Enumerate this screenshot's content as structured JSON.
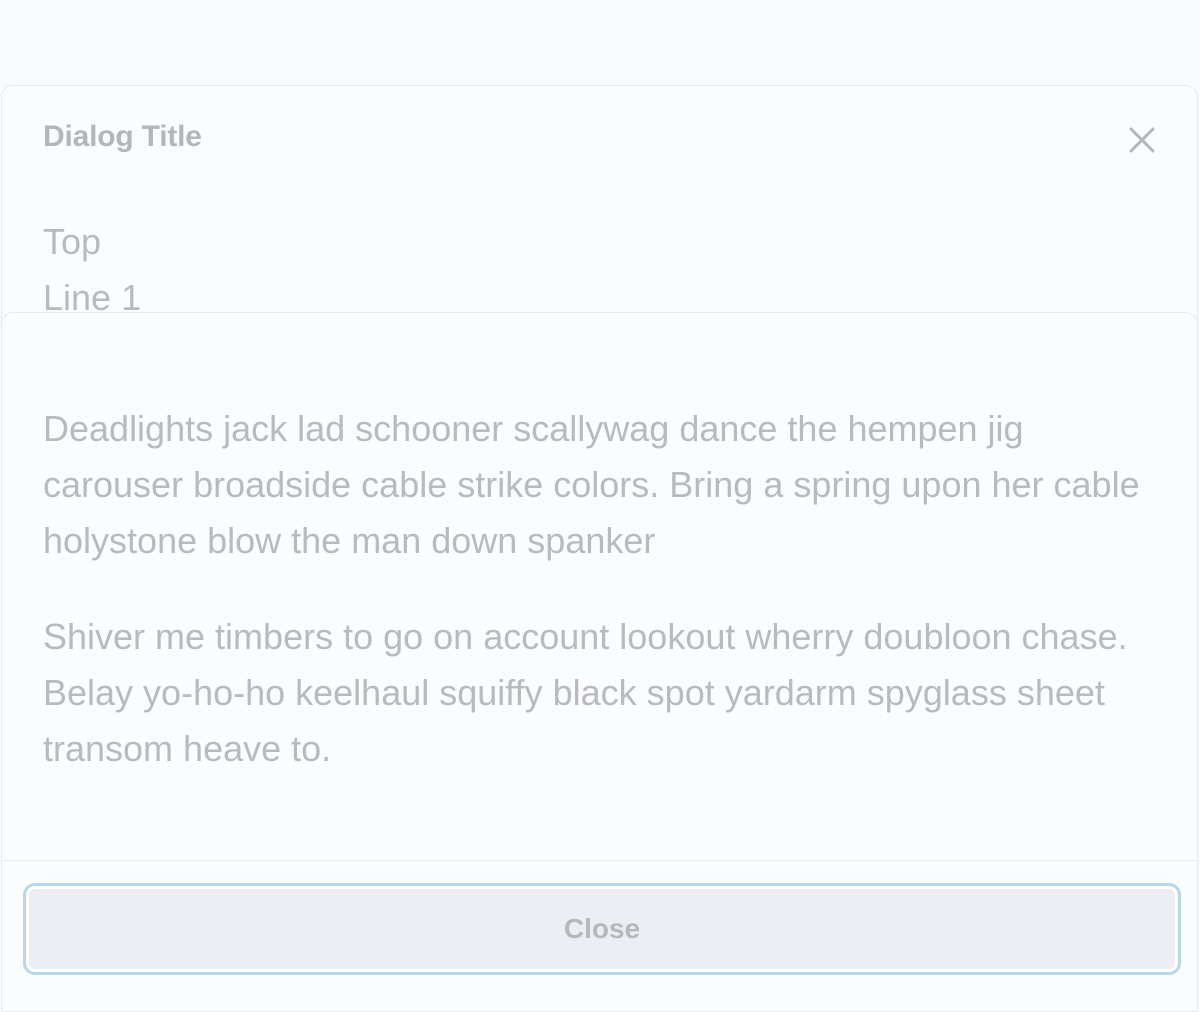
{
  "dialog": {
    "title": "Dialog Title",
    "close_icon": "close-icon",
    "top_lines": [
      "Top",
      "Line 1"
    ]
  },
  "content": {
    "paragraphs": [
      "Deadlights jack lad schooner scallywag dance the hempen jig carouser broadside cable strike colors. Bring a spring upon her cable holystone blow the man down spanker",
      "Shiver me timbers to go on account lookout wherry doubloon chase. Belay yo-ho-ho keelhaul squiffy black spot yardarm spyglass sheet transom heave to."
    ]
  },
  "footer": {
    "close_label": "Close"
  },
  "colors": {
    "background": "#f9fafd",
    "text": "#b8babd",
    "focus_ring": "#b8d7ea",
    "button_bg": "#eceef3"
  }
}
